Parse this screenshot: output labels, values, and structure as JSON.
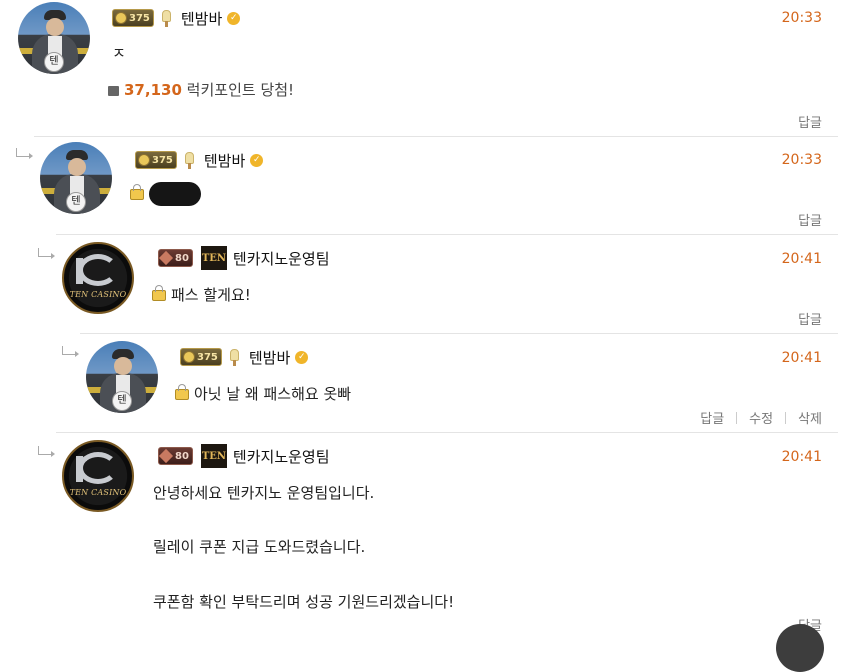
{
  "comments": [
    {
      "level": "375",
      "nickname": "텐밤바",
      "time": "20:33",
      "text": "ㅈ",
      "reward_points": "37,130",
      "reward_suffix": "럭키포인트 당첨!",
      "actions": [
        "답글"
      ]
    },
    {
      "level": "375",
      "nickname": "텐밤바",
      "time": "20:33",
      "text": "",
      "actions": [
        "답글"
      ]
    },
    {
      "level": "80",
      "badge": "TEN",
      "avatar_text": "TEN CASINO",
      "nickname": "텐카지노운영팀",
      "time": "20:41",
      "text": "패스 할게요!",
      "actions": [
        "답글"
      ]
    },
    {
      "level": "375",
      "nickname": "텐밤바",
      "time": "20:41",
      "text": "아닛 날 왜 패스해요 옷빠",
      "actions": [
        "답글",
        "수정",
        "삭제"
      ]
    },
    {
      "level": "80",
      "badge": "TEN",
      "avatar_text": "TEN CASINO",
      "nickname": "텐카지노운영팀",
      "time": "20:41",
      "lines": [
        "안녕하세요 텐카지노 운영팀입니다.",
        "릴레이 쿠폰 지급 도와드렸습니다.",
        "쿠폰함 확인 부탁드리며 성공 기원드리겠습니다!"
      ],
      "actions": [
        "답글"
      ]
    }
  ],
  "avatar_badge": "텐",
  "colors": {
    "time": "#d4661b",
    "points": "#d4661b"
  }
}
